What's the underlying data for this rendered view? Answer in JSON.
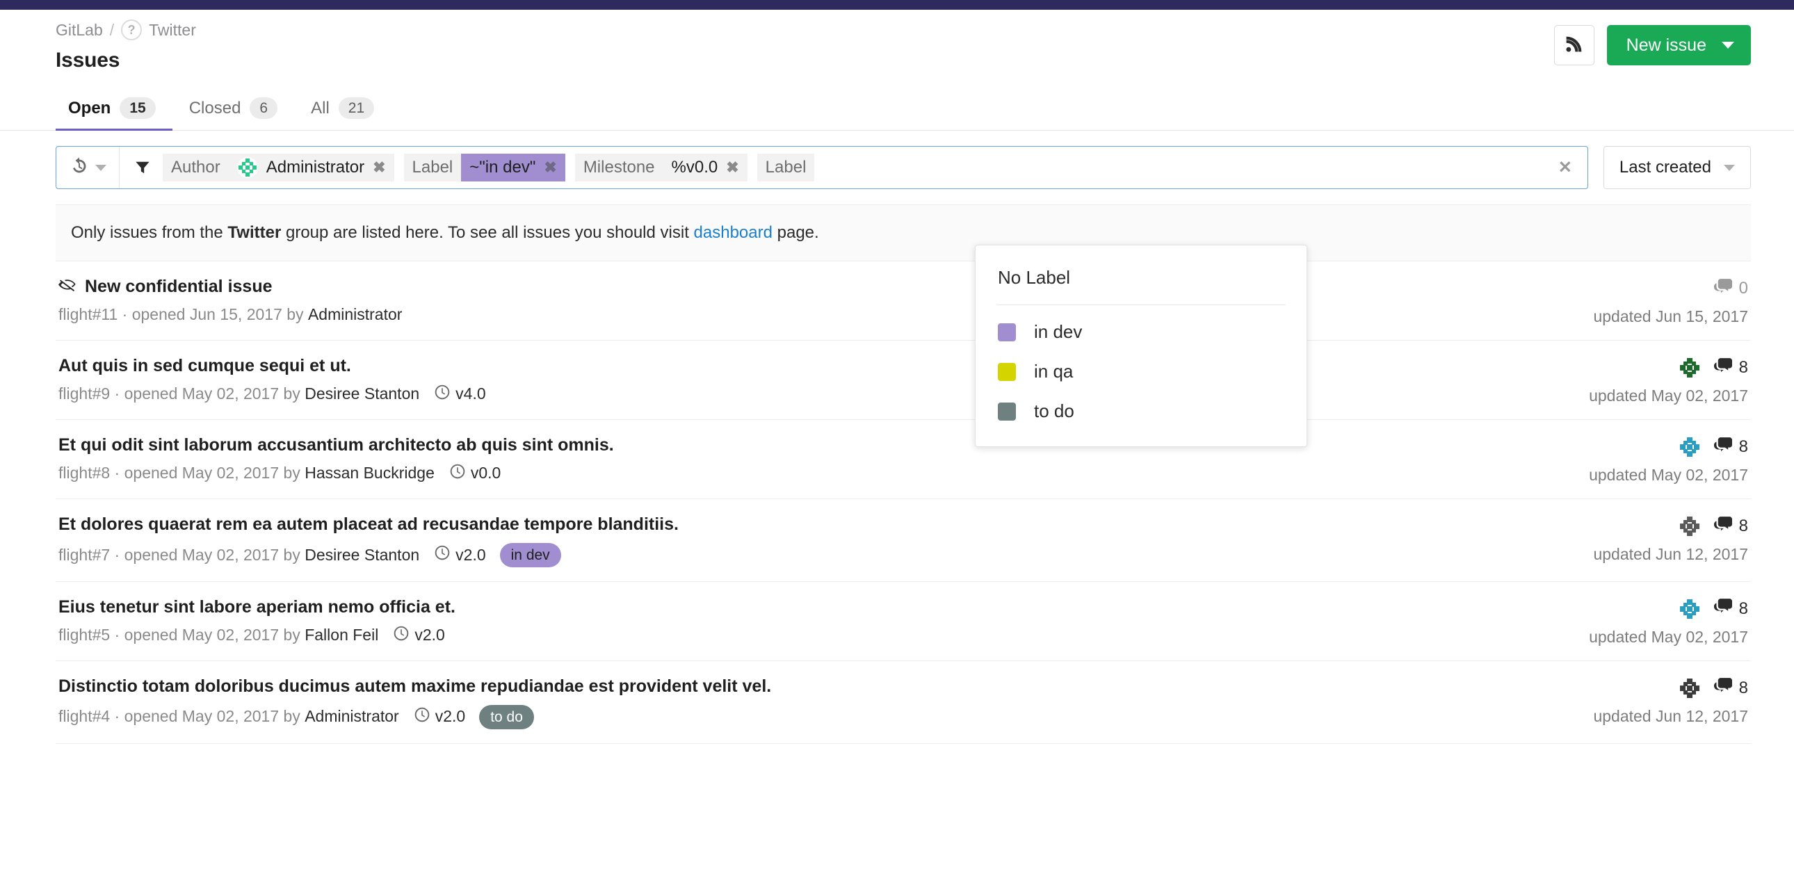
{
  "brand": {
    "topbar_color": "#2e2a5d",
    "accent_green": "#1aaa55",
    "accent_purple": "#6b5fc7"
  },
  "header": {
    "breadcrumb": {
      "group": "GitLab",
      "separator": "/",
      "project": "Twitter",
      "project_icon": "?"
    },
    "title": "Issues",
    "rss_icon": "rss-icon",
    "new_issue_label": "New issue"
  },
  "tabs": [
    {
      "label": "Open",
      "count": "15",
      "active": true
    },
    {
      "label": "Closed",
      "count": "6",
      "active": false
    },
    {
      "label": "All",
      "count": "21",
      "active": false
    }
  ],
  "filter_bar": {
    "recent_searches_icon": "history-icon",
    "filter_icon": "funnel-icon",
    "clear_all_icon": "✕",
    "tokens": [
      {
        "key": "Author",
        "value": "Administrator",
        "has_avatar": true,
        "highlight": false,
        "remove_icon": "✖"
      },
      {
        "key": "Label",
        "value": "~\"in dev\"",
        "has_avatar": false,
        "highlight": true,
        "remove_icon": "✖"
      },
      {
        "key": "Milestone",
        "value": "%v0.0",
        "has_avatar": false,
        "highlight": false,
        "remove_icon": "✖"
      },
      {
        "key": "Label",
        "value": "",
        "has_avatar": false,
        "highlight": false,
        "remove_icon": ""
      }
    ],
    "sort": {
      "label": "Last created"
    }
  },
  "label_dropdown": {
    "no_label": "No Label",
    "options": [
      {
        "label": "in dev",
        "color": "#a08ed0"
      },
      {
        "label": "in qa",
        "color": "#d4d400"
      },
      {
        "label": "to do",
        "color": "#6e8180"
      }
    ]
  },
  "info_banner": {
    "prefix": "Only issues from the ",
    "group": "Twitter",
    "middle": " group are listed here. To see all issues you should visit ",
    "link": "dashboard",
    "suffix": " page."
  },
  "issues": [
    {
      "confidential": true,
      "title": "New confidential issue",
      "ref": "flight#11",
      "opened": "opened Jun 15, 2017",
      "by": "by",
      "author": "Administrator",
      "milestone": "",
      "labels": [],
      "assignee_color": "",
      "comments": "0",
      "comments_zero": true,
      "updated": "updated Jun 15, 2017"
    },
    {
      "confidential": false,
      "title": "Aut quis in sed cumque sequi et ut.",
      "ref": "flight#9",
      "opened": "opened May 02, 2017",
      "by": "by",
      "author": "Desiree Stanton",
      "milestone": "v4.0",
      "labels": [],
      "assignee_color": "#1c6b2a",
      "comments": "8",
      "comments_zero": false,
      "updated": "updated May 02, 2017"
    },
    {
      "confidential": false,
      "title": "Et qui odit sint laborum accusantium architecto ab quis sint omnis.",
      "ref": "flight#8",
      "opened": "opened May 02, 2017",
      "by": "by",
      "author": "Hassan Buckridge",
      "milestone": "v0.0",
      "labels": [],
      "assignee_color": "#2a9ec0",
      "comments": "8",
      "comments_zero": false,
      "updated": "updated May 02, 2017"
    },
    {
      "confidential": false,
      "title": "Et dolores quaerat rem ea autem placeat ad recusandae tempore blanditiis.",
      "ref": "flight#7",
      "opened": "opened May 02, 2017",
      "by": "by",
      "author": "Desiree Stanton",
      "milestone": "v2.0",
      "labels": [
        {
          "text": "in dev",
          "bg": "#a08ed0",
          "fg": "#1e1e1e"
        }
      ],
      "assignee_color": "#5a5a5a",
      "comments": "8",
      "comments_zero": false,
      "updated": "updated Jun 12, 2017"
    },
    {
      "confidential": false,
      "title": "Eius tenetur sint labore aperiam nemo officia et.",
      "ref": "flight#5",
      "opened": "opened May 02, 2017",
      "by": "by",
      "author": "Fallon Feil",
      "milestone": "v2.0",
      "labels": [],
      "assignee_color": "#2a9ec0",
      "comments": "8",
      "comments_zero": false,
      "updated": "updated May 02, 2017"
    },
    {
      "confidential": false,
      "title": "Distinctio totam doloribus ducimus autem maxime repudiandae est provident velit vel.",
      "ref": "flight#4",
      "opened": "opened May 02, 2017",
      "by": "by",
      "author": "Administrator",
      "milestone": "v2.0",
      "labels": [
        {
          "text": "to do",
          "bg": "#6e8180",
          "fg": "#ffffff"
        }
      ],
      "assignee_color": "#3c3c3c",
      "comments": "8",
      "comments_zero": false,
      "updated": "updated Jun 12, 2017"
    }
  ]
}
